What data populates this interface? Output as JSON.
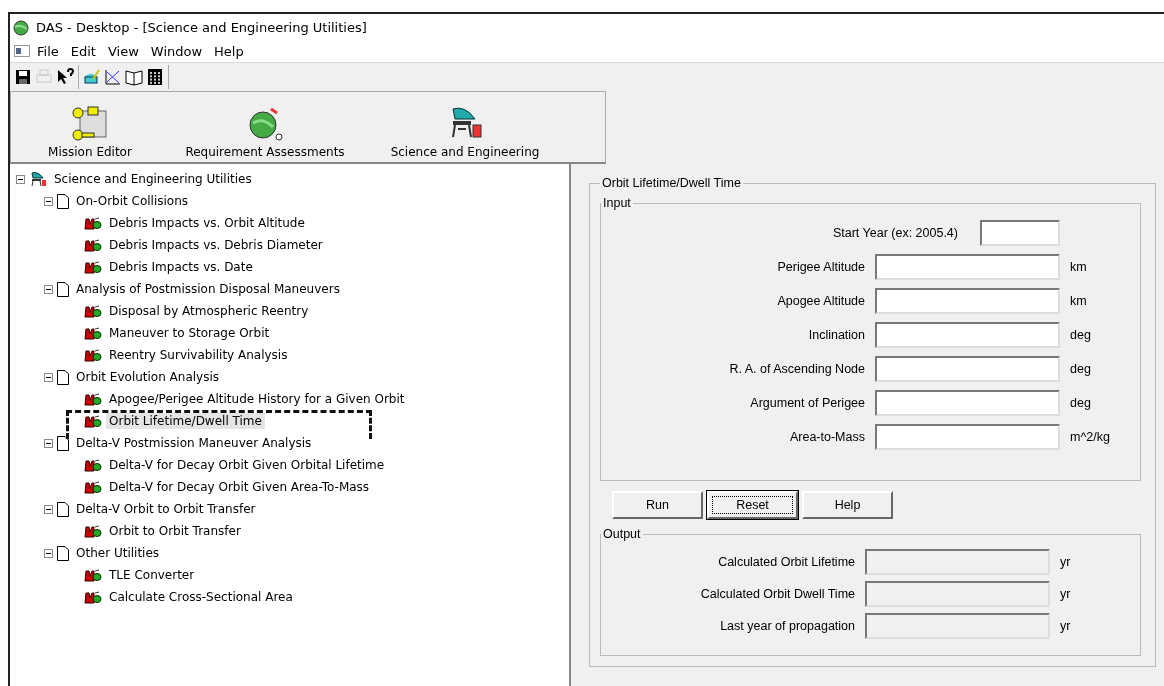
{
  "window": {
    "title": "DAS - Desktop - [Science and Engineering Utilities]"
  },
  "menu": [
    "File",
    "Edit",
    "View",
    "Window",
    "Help"
  ],
  "toolbar": [
    {
      "kind": "save",
      "disabled": false
    },
    {
      "kind": "print",
      "disabled": true
    },
    {
      "kind": "help",
      "disabled": false
    },
    {
      "kind": "sep"
    },
    {
      "kind": "edit",
      "disabled": false
    },
    {
      "kind": "graph",
      "disabled": false
    },
    {
      "kind": "book",
      "disabled": false
    },
    {
      "kind": "calc",
      "disabled": false
    }
  ],
  "modules": [
    {
      "label": "Mission Editor",
      "kind": "editor"
    },
    {
      "label": "Requirement Assessments",
      "kind": "globe"
    },
    {
      "label": "Science and Engineering",
      "kind": "lab"
    }
  ],
  "tree": {
    "label": "Science and Engineering Utilities",
    "expanded": true,
    "children": [
      {
        "label": "On-Orbit Collisions",
        "expanded": true,
        "children": [
          {
            "label": "Debris Impacts vs. Orbit Altitude",
            "selected": false
          },
          {
            "label": "Debris Impacts vs. Debris Diameter",
            "selected": false
          },
          {
            "label": "Debris Impacts vs. Date",
            "selected": false
          }
        ]
      },
      {
        "label": "Analysis of Postmission Disposal Maneuvers",
        "expanded": true,
        "children": [
          {
            "label": "Disposal by Atmospheric Reentry",
            "selected": false
          },
          {
            "label": "Maneuver to Storage Orbit",
            "selected": false
          },
          {
            "label": "Reentry Survivability Analysis",
            "selected": false
          }
        ]
      },
      {
        "label": "Orbit Evolution Analysis",
        "expanded": true,
        "children": [
          {
            "label": "Apogee/Perigee Altitude History for a Given Orbit",
            "selected": false
          },
          {
            "label": "Orbit Lifetime/Dwell Time",
            "selected": true
          }
        ]
      },
      {
        "label": "Delta-V Postmission Maneuver Analysis",
        "expanded": true,
        "children": [
          {
            "label": "Delta-V for Decay Orbit Given Orbital Lifetime",
            "selected": false
          },
          {
            "label": "Delta-V for Decay Orbit Given Area-To-Mass",
            "selected": false
          }
        ]
      },
      {
        "label": "Delta-V Orbit to Orbit Transfer",
        "expanded": true,
        "children": [
          {
            "label": "Orbit to Orbit Transfer",
            "selected": false
          }
        ]
      },
      {
        "label": "Other Utilities",
        "expanded": true,
        "children": [
          {
            "label": "TLE Converter",
            "selected": false
          },
          {
            "label": "Calculate Cross-Sectional Area",
            "selected": false
          }
        ]
      }
    ]
  },
  "panel": {
    "title": "Orbit Lifetime/Dwell Time",
    "input": {
      "title": "Input",
      "fields": [
        {
          "kind": "year",
          "label": "Start Year (ex: 2005.4)"
        },
        {
          "kind": "measure",
          "label": "Perigee Altitude",
          "unit": "km"
        },
        {
          "kind": "measure",
          "label": "Apogee Altitude",
          "unit": "km"
        },
        {
          "kind": "measure",
          "label": "Inclination",
          "unit": "deg"
        },
        {
          "kind": "measure",
          "label": "R. A. of Ascending Node",
          "unit": "deg"
        },
        {
          "kind": "measure",
          "label": "Argument of Perigee",
          "unit": "deg"
        },
        {
          "kind": "measure",
          "label": "Area-to-Mass",
          "unit": "m^2/kg"
        }
      ]
    },
    "buttons": [
      {
        "label": "Run",
        "focused": false
      },
      {
        "label": "Reset",
        "focused": true
      },
      {
        "label": "Help",
        "focused": false
      }
    ],
    "output": {
      "title": "Output",
      "fields": [
        {
          "label": "Calculated Orbit Lifetime",
          "unit": "yr",
          "disabled": true
        },
        {
          "label": "Calculated Orbit Dwell Time",
          "unit": "yr",
          "disabled": true
        },
        {
          "label": "Last year of propagation",
          "unit": "yr",
          "disabled": true
        }
      ]
    }
  }
}
